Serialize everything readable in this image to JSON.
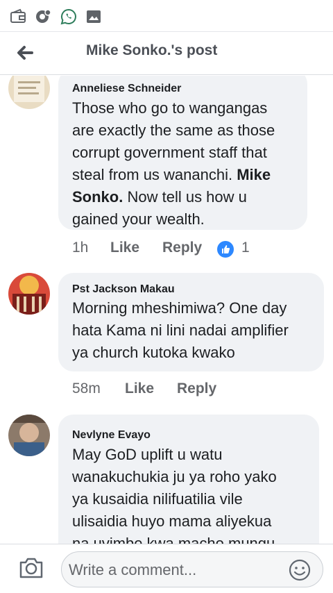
{
  "status_bar": {
    "icons": [
      "wallet-icon",
      "chat-notification-icon",
      "whatsapp-icon",
      "gallery-icon"
    ]
  },
  "header": {
    "title": "Mike Sonko.'s post",
    "back_icon": "arrow-left-icon"
  },
  "comments": [
    {
      "author": "Anneliese Schneider",
      "text_lines": [
        "Those who go to wangangas",
        "are exactly the same as those",
        "corrupt government staff that",
        "steal from us wananchi.",
        "Mike",
        "Sonko.",
        "Now tell us how u",
        "gained your wealth."
      ],
      "time": "1h",
      "like_label": "Like",
      "reply_label": "Reply",
      "reaction_count": "1"
    },
    {
      "author": "Pst Jackson Makau",
      "text_lines": [
        "Morning mheshimiwa?  One day",
        "hata Kama ni lini nadai amplifier",
        "ya church kutoka kwako"
      ],
      "time": "58m",
      "like_label": "Like",
      "reply_label": "Reply"
    },
    {
      "author": "Nevlyne Evayo",
      "text_lines": [
        "May GoD uplift u watu",
        "wanakuchukia ju ya roho yako",
        "ya kusaidia nilifuatilia vile",
        "ulisaidia huyo mama aliyekua",
        "na uvimbe kwa macho mungu"
      ]
    }
  ],
  "composer": {
    "placeholder": "Write a comment...",
    "camera_icon": "camera-icon",
    "emoji_icon": "emoji-icon"
  },
  "colors": {
    "bubble": "#f0f2f5",
    "meta_text": "#65676b",
    "like_badge": "#2d88ff",
    "title_text": "#4b4f56"
  }
}
